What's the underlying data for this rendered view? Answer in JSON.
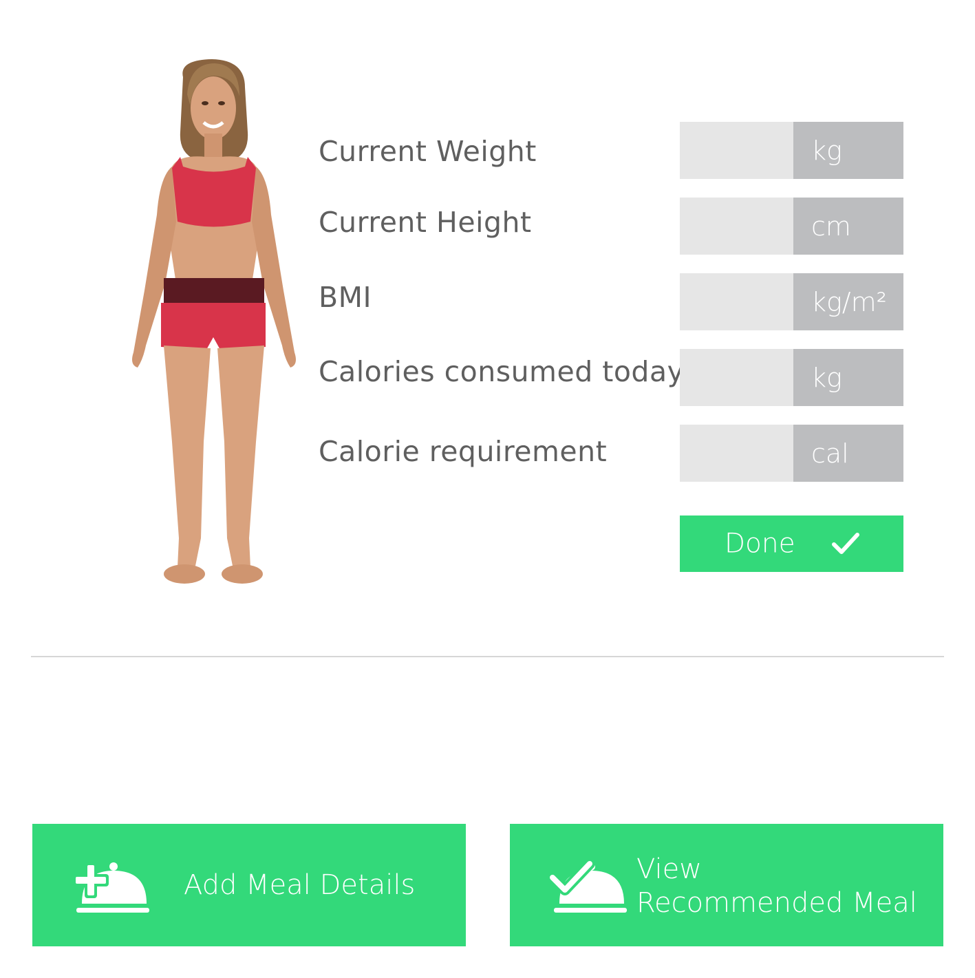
{
  "form": {
    "rows": [
      {
        "label": "Current Weight",
        "unit": "kg"
      },
      {
        "label": "Current Height",
        "unit": "cm"
      },
      {
        "label": "BMI",
        "unit": "kg/m²"
      },
      {
        "label": "Calories consumed today",
        "unit": "kg"
      },
      {
        "label": "Calorie requirement",
        "unit": "cal"
      }
    ],
    "done_label": "Done"
  },
  "actions": {
    "add_meal_label": "Add Meal Details",
    "view_meal_line1": "View",
    "view_meal_line2": "Recommended Meal"
  },
  "colors": {
    "accent": "#33d97a",
    "input_bg": "#e6e6e6",
    "unit_bg": "#bcbdbf",
    "label_text": "#5f5f5f",
    "outfit": "#d8344a",
    "waistband": "#5a1a22"
  },
  "icons": {
    "done": "check-icon",
    "add_meal": "cloche-plus-icon",
    "view_meal": "cloche-check-icon"
  }
}
